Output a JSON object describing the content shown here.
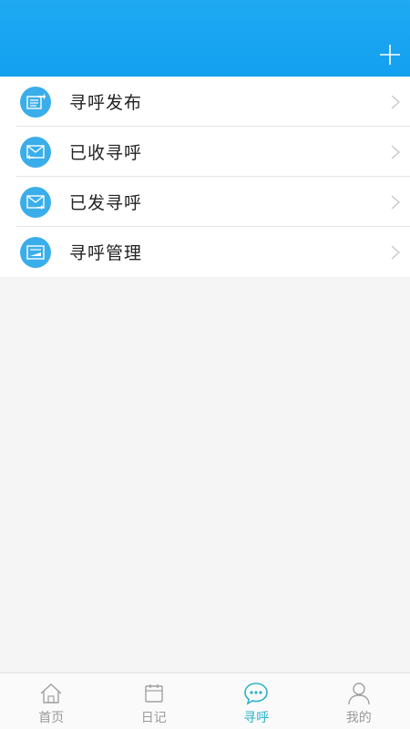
{
  "header": {
    "title": "",
    "add_icon": "plus-icon"
  },
  "menu": {
    "items": [
      {
        "label": "寻呼发布",
        "icon": "publish-icon"
      },
      {
        "label": "已收寻呼",
        "icon": "mail-inbox-icon"
      },
      {
        "label": "已发寻呼",
        "icon": "mail-sent-icon"
      },
      {
        "label": "寻呼管理",
        "icon": "manage-icon"
      }
    ]
  },
  "tabbar": {
    "tabs": [
      {
        "label": "首页",
        "icon": "home-icon"
      },
      {
        "label": "日记",
        "icon": "calendar-icon"
      },
      {
        "label": "寻呼",
        "icon": "chat-bubble-icon",
        "active": true
      },
      {
        "label": "我的",
        "icon": "user-icon"
      }
    ]
  },
  "colors": {
    "header_bg": "#12a0ef",
    "icon_circle": "#3aaeea",
    "tab_active": "#2ab2c8",
    "tab_inactive": "#9a9a9a"
  }
}
